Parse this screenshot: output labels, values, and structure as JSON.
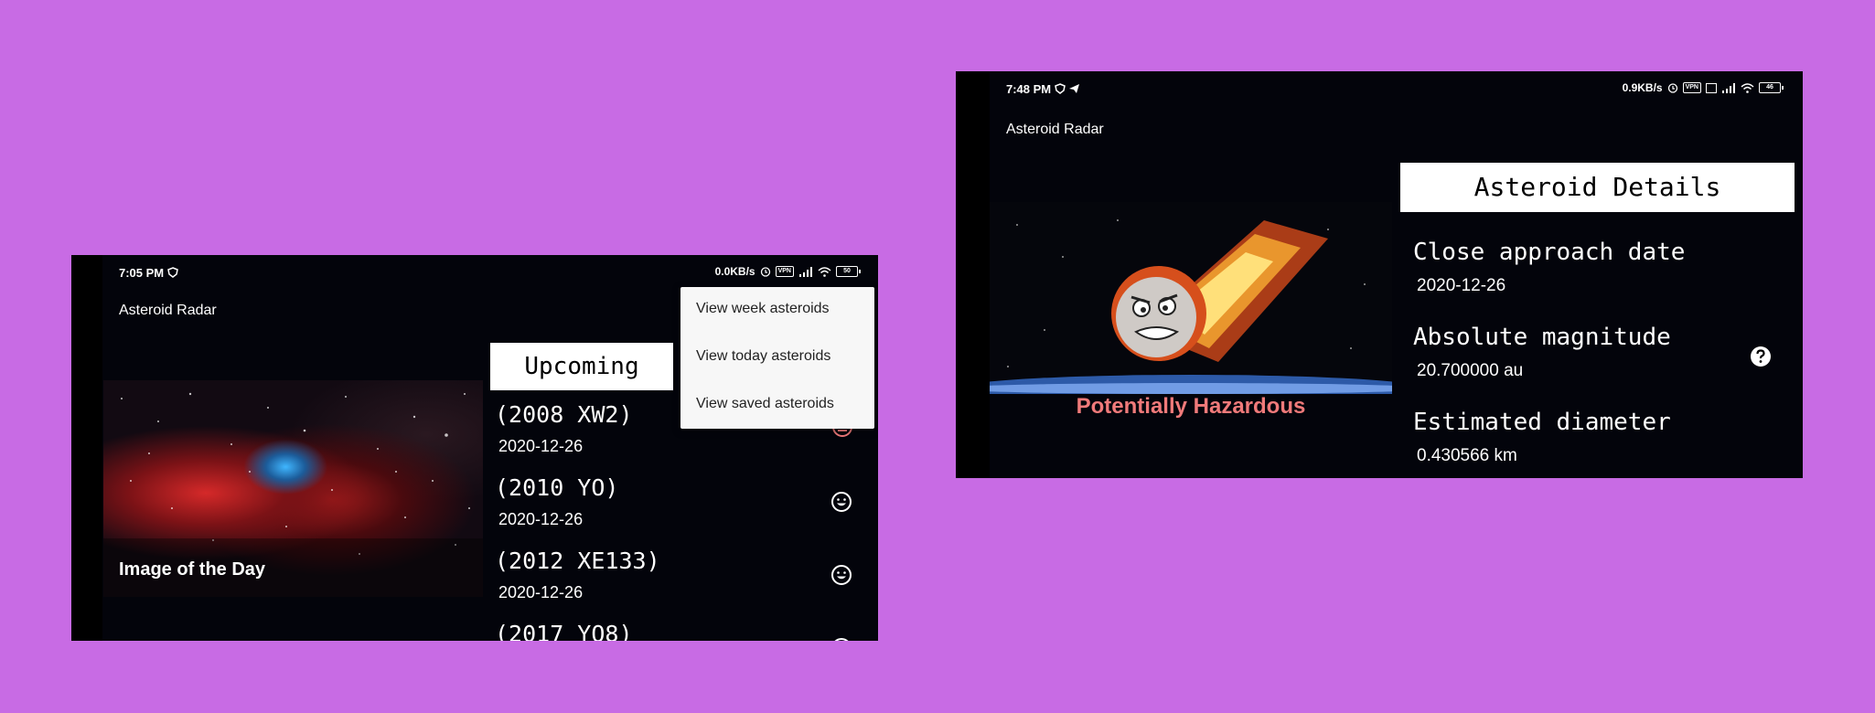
{
  "left_phone": {
    "status": {
      "time": "7:05 PM",
      "net_speed": "0.0KB/s",
      "vpn": "VPN",
      "battery": "50"
    },
    "app_title": "Asteroid Radar",
    "image_caption": "Image of the Day",
    "header": "Upcoming",
    "menu": {
      "items": [
        {
          "label": "View week asteroids"
        },
        {
          "label": "View today asteroids"
        },
        {
          "label": "View saved asteroids"
        }
      ]
    },
    "asteroids": [
      {
        "name": "(2008 XW2)",
        "date": "2020-12-26",
        "status_icon": "hazard-face-icon"
      },
      {
        "name": "(2010 YO)",
        "date": "2020-12-26",
        "status_icon": "smiley-face-icon"
      },
      {
        "name": "(2012 XE133)",
        "date": "2020-12-26",
        "status_icon": "smiley-face-icon"
      },
      {
        "name": "(2017 YO8)",
        "date": "",
        "status_icon": "smiley-face-icon"
      }
    ]
  },
  "right_phone": {
    "status": {
      "time": "7:48 PM",
      "net_speed": "0.9KB/s",
      "vpn": "VPN",
      "battery": "46"
    },
    "app_title": "Asteroid Radar",
    "header": "Asteroid Details",
    "hazard_label": "Potentially Hazardous",
    "details": [
      {
        "label": "Close approach date",
        "value": "2020-12-26"
      },
      {
        "label": "Absolute magnitude",
        "value": "20.700000 au"
      },
      {
        "label": "Estimated diameter",
        "value": "0.430566 km"
      }
    ]
  },
  "colors": {
    "background": "#c86be4",
    "screen": "#03040b",
    "hazard": "#f07a7a"
  }
}
